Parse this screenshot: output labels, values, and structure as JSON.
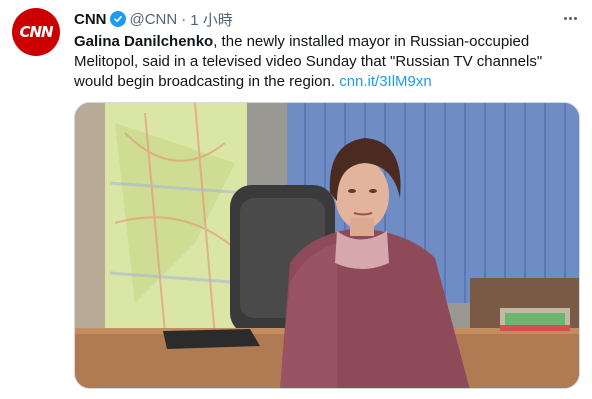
{
  "avatar": {
    "logo_text": "CNN",
    "brand_color": "#cc0000"
  },
  "tweet": {
    "display_name": "CNN",
    "handle": "@CNN",
    "separator": "·",
    "time": "1 小時",
    "body_bold": "Galina Danilchenko",
    "body_line1_rest": ", the newly installed mayor in Russian-occupied",
    "body_line2": "Melitopol, said in a televised video Sunday that \"Russian TV channels\"",
    "body_line3": "would begin broadcasting in the region.",
    "link_text": "cnn.it/3IlM9xn"
  },
  "colors": {
    "verified": "#1d9bf0",
    "link": "#1d9bf0",
    "secondary_text": "#536471"
  },
  "icons": {
    "verified": "verified-badge-icon",
    "more": "more-options-icon"
  }
}
